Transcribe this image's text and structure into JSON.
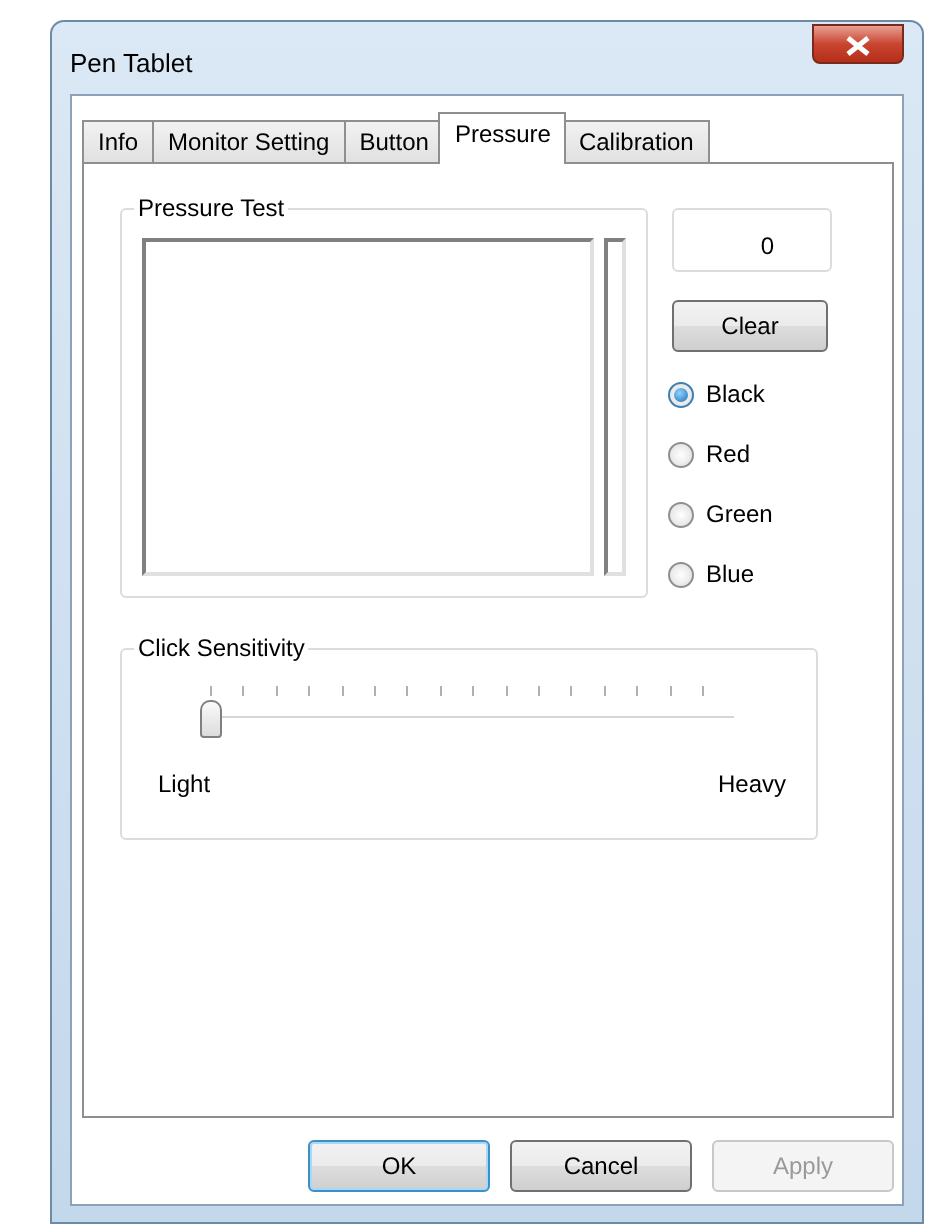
{
  "window": {
    "title": "Pen Tablet"
  },
  "tabs": [
    {
      "label": "Info",
      "selected": false
    },
    {
      "label": "Monitor Setting",
      "selected": false
    },
    {
      "label": "Button",
      "selected": false
    },
    {
      "label": "Pressure",
      "selected": true
    },
    {
      "label": "Calibration",
      "selected": false
    }
  ],
  "pressure_test": {
    "title": "Pressure Test",
    "reading": "0",
    "clear_button": "Clear",
    "colors": [
      {
        "label": "Black",
        "selected": true
      },
      {
        "label": "Red",
        "selected": false
      },
      {
        "label": "Green",
        "selected": false
      },
      {
        "label": "Blue",
        "selected": false
      }
    ]
  },
  "click_sensitivity": {
    "title": "Click Sensitivity",
    "level": 0,
    "min_label": "Light",
    "max_label": "Heavy"
  },
  "buttons": [
    {
      "label": "OK",
      "disabled": false,
      "default": true
    },
    {
      "label": "Cancel",
      "disabled": false,
      "default": false
    },
    {
      "label": "Apply",
      "disabled": true,
      "default": false
    }
  ]
}
